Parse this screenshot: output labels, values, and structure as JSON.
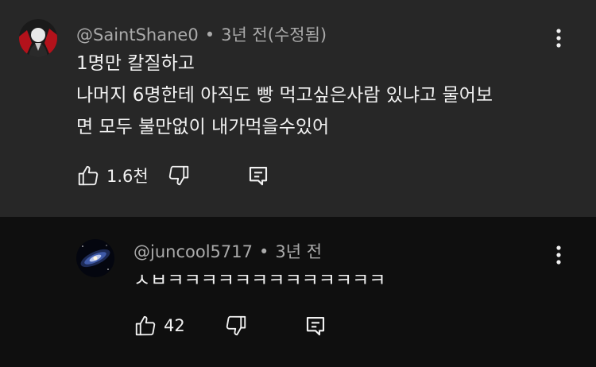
{
  "comments": [
    {
      "author": "@SaintShane0",
      "time": "3년 전(수정됨)",
      "lines": [
        "1명만 칼질하고",
        "나머지 6명한테 아직도 빵 먹고싶은사람 있냐고 물어보",
        "면 모두 불만없이 내가먹을수있어"
      ],
      "likes": "1.6천",
      "icons": {
        "like": "thumbs-up-icon",
        "dislike": "thumbs-down-icon",
        "reply": "reply-icon",
        "more": "more-vert-icon"
      }
    },
    {
      "author": "@juncool5717",
      "time": "3년 전",
      "lines": [
        "ㅅㅂㅋㅋㅋㅋㅋㅋㅋㅋㅋㅋㅋㅋㅋ"
      ],
      "likes": "42",
      "icons": {
        "like": "thumbs-up-icon",
        "dislike": "thumbs-down-icon",
        "reply": "reply-icon",
        "more": "more-vert-icon"
      }
    }
  ],
  "colors": {
    "top_bg": "#272727",
    "reply_bg": "#0f0f0f",
    "text": "#f1f1f1",
    "meta": "#aaaaaa"
  }
}
